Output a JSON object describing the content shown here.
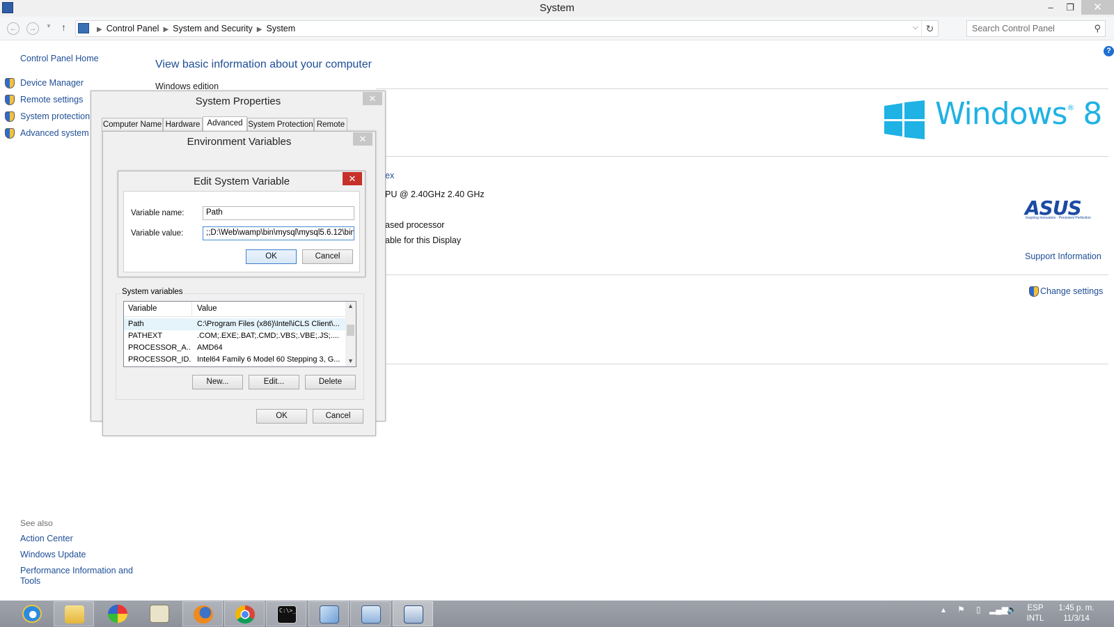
{
  "window": {
    "title": "System",
    "minimize": "–",
    "maximize": "❐",
    "close": "✕"
  },
  "nav": {
    "back": "←",
    "forward": "→",
    "up": "↑",
    "breadcrumbs": [
      "Control Panel",
      "System and Security",
      "System"
    ],
    "search_placeholder": "Search Control Panel"
  },
  "left_pane": {
    "home": "Control Panel Home",
    "tasks": [
      "Device Manager",
      "Remote settings",
      "System protection",
      "Advanced system s"
    ],
    "see_also_label": "See also",
    "see_also": [
      "Action Center",
      "Windows Update",
      "Performance Information and",
      "Tools"
    ]
  },
  "main": {
    "heading": "View basic information about your computer",
    "windows_edition": "Windows edition",
    "windows_logo_text": "Windows",
    "windows_logo_version": "8",
    "partial_texts": [
      "ex",
      "PU @ 2.40GHz   2.40 GHz",
      "ased processor",
      "able for this Display"
    ],
    "oem_logo": "ASUS",
    "oem_tagline": "Inspiring Innovation · Persistent Perfection",
    "support_information": "Support Information",
    "change_settings": "Change settings"
  },
  "system_properties": {
    "title": "System Properties",
    "close": "✕",
    "tabs": [
      "Computer Name",
      "Hardware",
      "Advanced",
      "System Protection",
      "Remote"
    ],
    "active_tab": "Advanced"
  },
  "environment_variables": {
    "title": "Environment Variables",
    "close": "✕",
    "system_variables_label": "System variables",
    "columns": [
      "Variable",
      "Value"
    ],
    "rows": [
      {
        "variable": "Path",
        "value": "C:\\Program Files (x86)\\Intel\\iCLS Client\\..."
      },
      {
        "variable": "PATHEXT",
        "value": ".COM;.EXE;.BAT;.CMD;.VBS;.VBE;.JS;...."
      },
      {
        "variable": "PROCESSOR_A...",
        "value": "AMD64"
      },
      {
        "variable": "PROCESSOR_ID...",
        "value": "Intel64 Family 6 Model 60 Stepping 3, G..."
      }
    ],
    "new_button": "New...",
    "edit_button": "Edit...",
    "delete_button": "Delete",
    "ok_button": "OK",
    "cancel_button": "Cancel"
  },
  "edit_system_variable": {
    "title": "Edit System Variable",
    "close": "✕",
    "name_label": "Variable name:",
    "name_value": "Path",
    "value_label": "Variable value:",
    "value_value": ";;D:\\Web\\wamp\\bin\\mysql\\mysql5.6.12\\bin",
    "ok_button": "OK",
    "cancel_button": "Cancel"
  },
  "taskbar": {
    "language": "ESP",
    "keyboard": "INTL",
    "time": "1:45 p. m.",
    "date": "11/3/14",
    "cmd_icon_text": "C:\\>_"
  }
}
